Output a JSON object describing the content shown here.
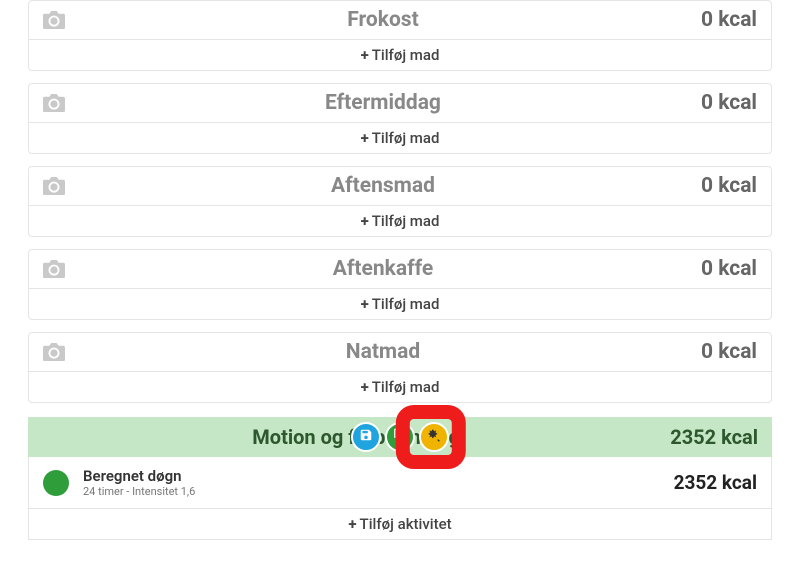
{
  "meals": [
    {
      "title": "Frokost",
      "kcal": "0 kcal",
      "add_label": "Tilføj mad"
    },
    {
      "title": "Eftermiddag",
      "kcal": "0 kcal",
      "add_label": "Tilføj mad"
    },
    {
      "title": "Aftensmad",
      "kcal": "0 kcal",
      "add_label": "Tilføj mad"
    },
    {
      "title": "Aftenkaffe",
      "kcal": "0 kcal",
      "add_label": "Tilføj mad"
    },
    {
      "title": "Natmad",
      "kcal": "0 kcal",
      "add_label": "Tilføj mad"
    }
  ],
  "activity": {
    "header_title": "Motion og forbrænding",
    "header_kcal": "2352 kcal",
    "item": {
      "name": "Beregnet døgn",
      "sub": "24 timer - Intensitet 1,6",
      "kcal": "2352 kcal"
    },
    "add_label": "Tilføj aktivitet"
  },
  "fab_icons": {
    "save": "save-icon",
    "copy": "copy-icon",
    "magic": "magic-wand-icon"
  },
  "colors": {
    "activity_bg": "#c5e7c5",
    "activity_text": "#2d572d",
    "highlight": "#ef1c1c",
    "green": "#2e9d3a"
  }
}
